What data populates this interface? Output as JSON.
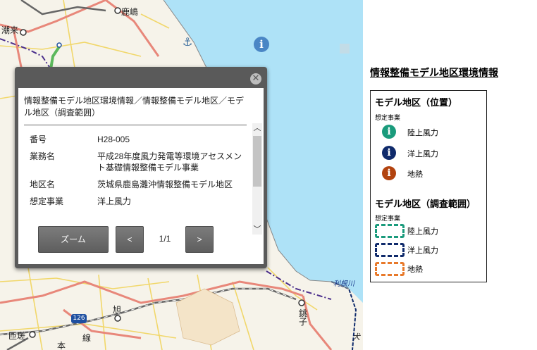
{
  "map": {
    "place_labels": [
      {
        "id": "kashima",
        "text": "鹿嶋"
      },
      {
        "id": "itako",
        "text": "潮来"
      },
      {
        "id": "asahi",
        "text": "旭"
      },
      {
        "id": "choshi_1",
        "text": "銚"
      },
      {
        "id": "choshi_2",
        "text": "子"
      },
      {
        "id": "hikata",
        "text": "匝瑳"
      },
      {
        "id": "tone_river",
        "text": "利根川"
      },
      {
        "id": "hon",
        "text": "本"
      },
      {
        "id": "sen",
        "text": "線"
      },
      {
        "id": "inubo",
        "text": "犬"
      }
    ],
    "route_number": "126",
    "colors": {
      "sea": "#aee2f7",
      "land": "#f6f3ea",
      "road": "#e8877a",
      "rail": "#666666",
      "boundary": "#4b2f8c",
      "green_line": "#5cb85c",
      "survey_area": "#0e2a6b"
    }
  },
  "popup": {
    "title": "情報整備モデル地区環境情報／情報整備モデル地区／モデル地区（調査範囲）",
    "rows": [
      {
        "key": "番号",
        "value": "H28-005"
      },
      {
        "key": "業務名",
        "value": "平成28年度風力発電等環境アセスメント基礎情報整備モデル事業"
      },
      {
        "key": "地区名",
        "value": "茨城県鹿島灘沖情報整備モデル地区"
      },
      {
        "key": "想定事業",
        "value": "洋上風力"
      }
    ],
    "zoom_label": "ズーム",
    "prev_label": "<",
    "next_label": ">",
    "pager": "1/1",
    "close_icon": "close-icon"
  },
  "legend": {
    "title": "情報整備モデル地区環境情報",
    "section_position": "モデル地区（位置）",
    "section_area": "モデル地区（調査範囲）",
    "sub_label": "想定事業",
    "points": [
      {
        "label": "陸上風力",
        "color": "#1a9b7c"
      },
      {
        "label": "洋上風力",
        "color": "#0f2a6b"
      },
      {
        "label": "地熱",
        "color": "#b2430f"
      }
    ],
    "areas": [
      {
        "label": "陸上風力",
        "color": "#1a9b7c"
      },
      {
        "label": "洋上風力",
        "color": "#0f2a6b"
      },
      {
        "label": "地熱",
        "color": "#e8792a"
      }
    ]
  }
}
